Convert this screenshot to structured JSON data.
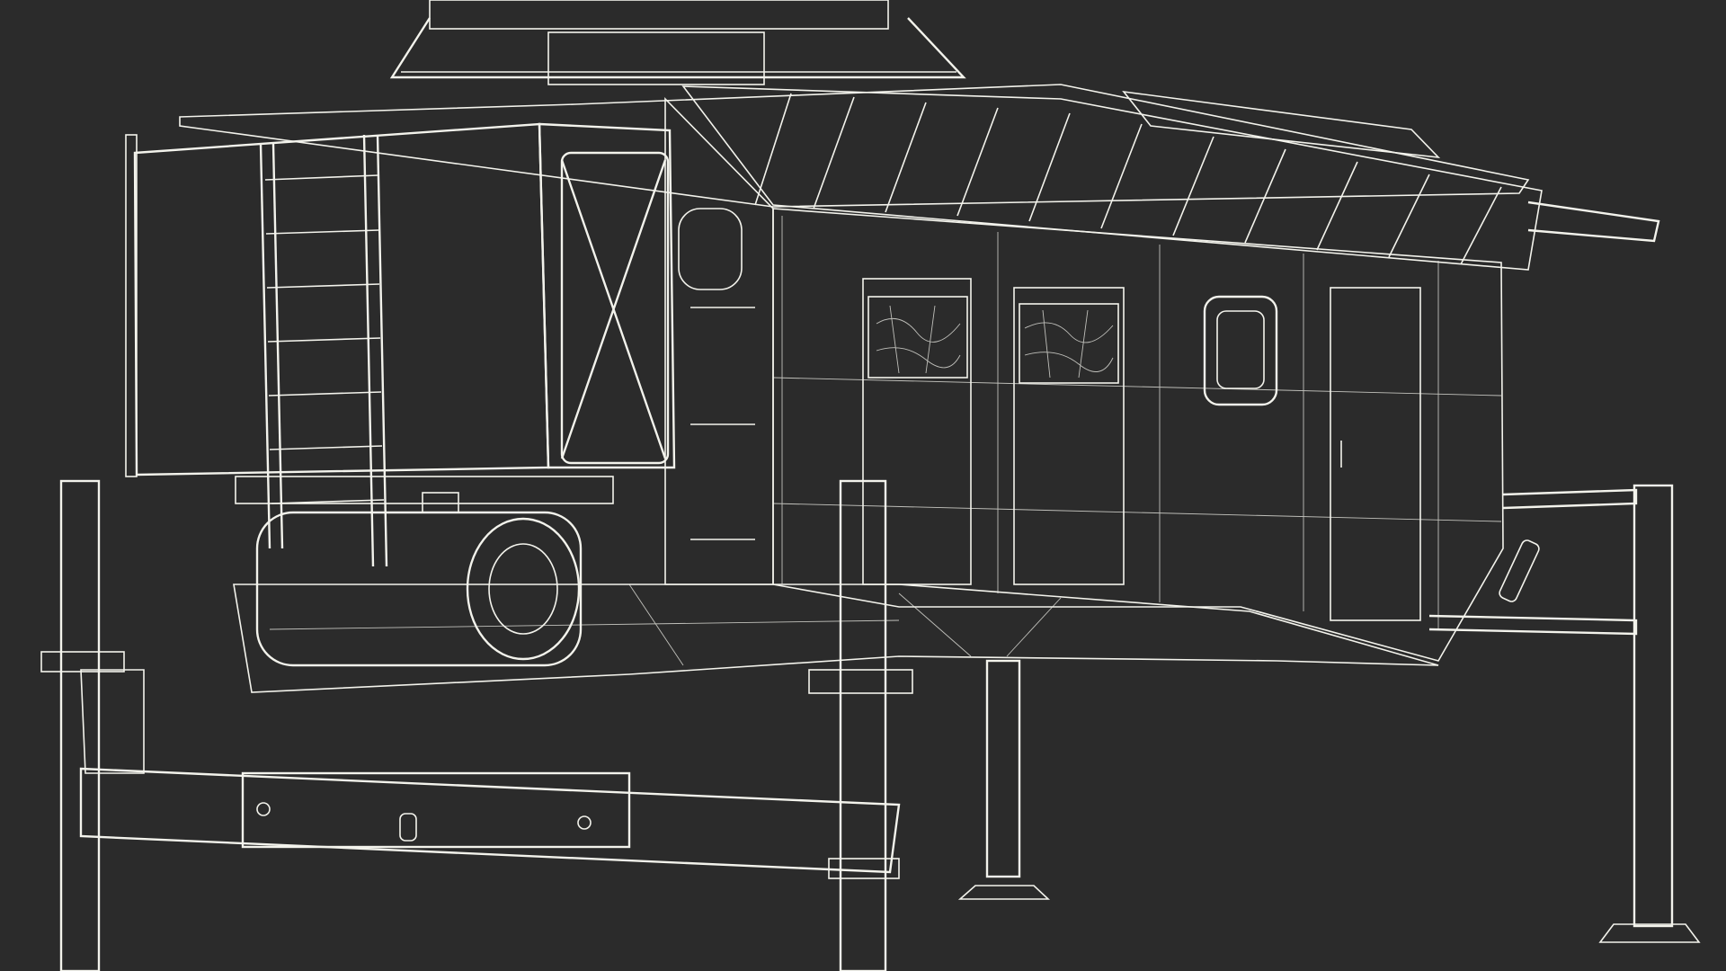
{
  "scene": {
    "subject": "wireframe-render",
    "colors": {
      "background": "#2b2b2b",
      "surface": "#6e6e68",
      "surface_dark": "#5a5a55",
      "surface_light": "#85857e",
      "wire": "#f3f3ec",
      "perforation": "#1c1c1c"
    }
  }
}
